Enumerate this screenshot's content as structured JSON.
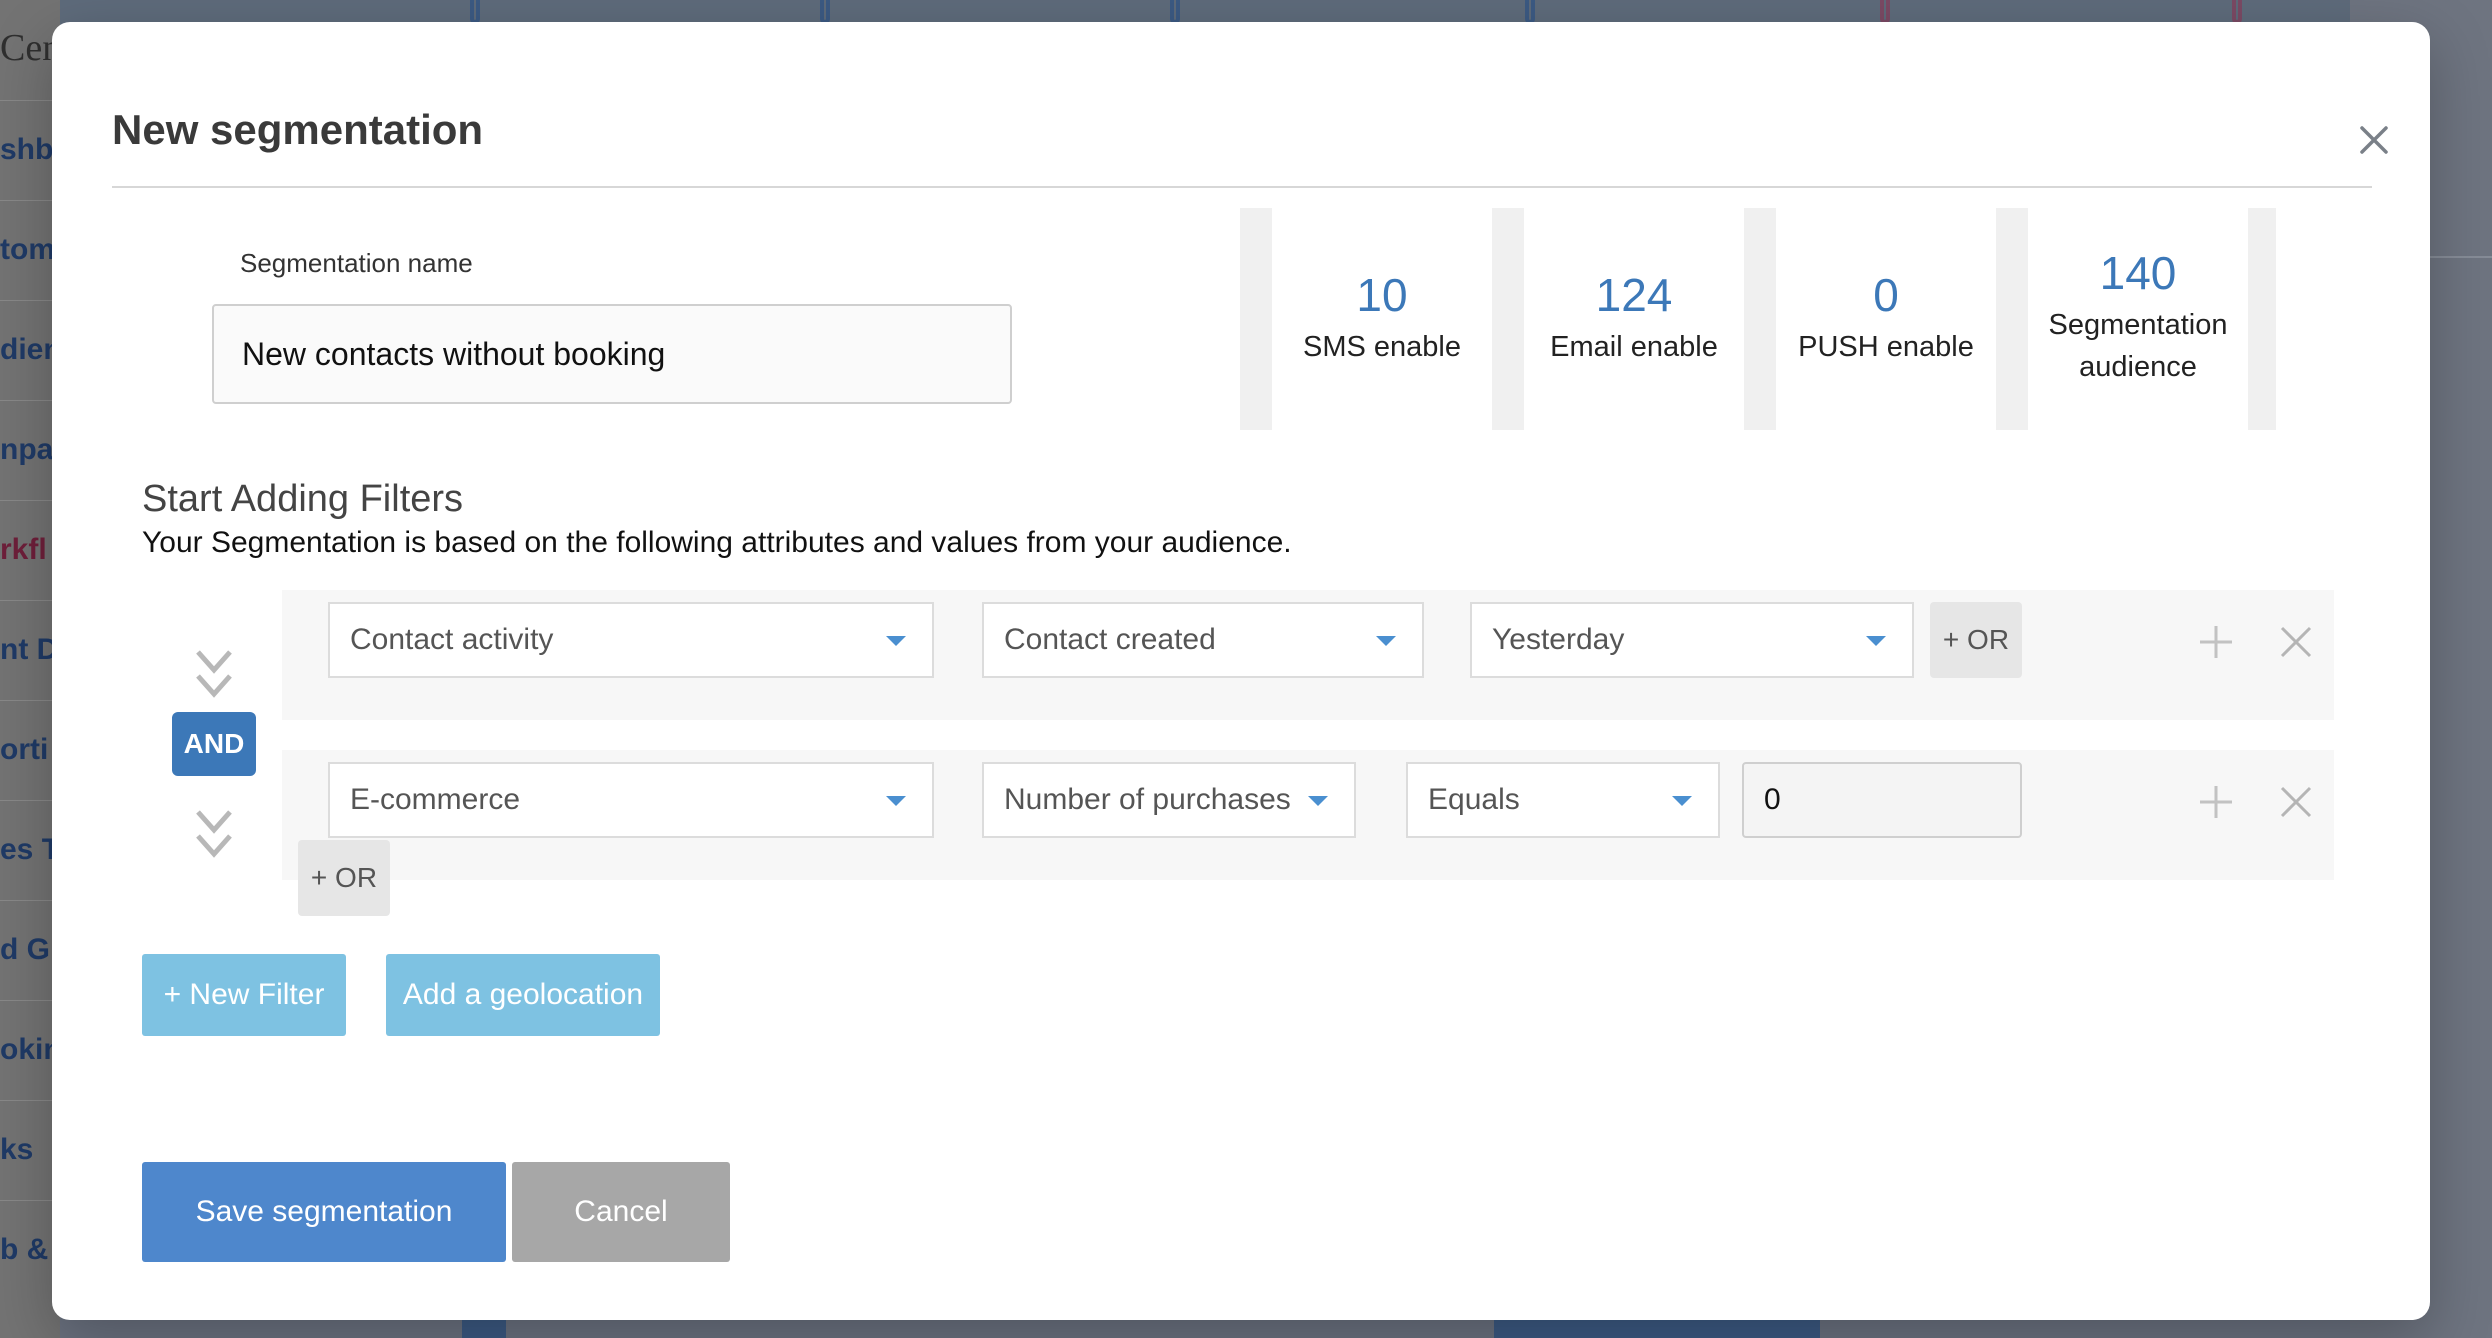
{
  "background": {
    "brand_fragment": "Cen",
    "nav_fragments": [
      "shbo",
      "tom",
      "dien",
      "npa",
      "rkfl",
      "nt D",
      "orti",
      "es T",
      "d G",
      "okin",
      "ks",
      "b &"
    ]
  },
  "modal": {
    "title": "New segmentation",
    "segmentation_name_label": "Segmentation name",
    "segmentation_name_value": "New contacts without booking",
    "stats": [
      {
        "number": "10",
        "label": "SMS enable"
      },
      {
        "number": "124",
        "label": "Email enable"
      },
      {
        "number": "0",
        "label": "PUSH enable"
      },
      {
        "number": "140",
        "label_line1": "Segmentation",
        "label_line2": "audience"
      }
    ],
    "filters_title": "Start Adding Filters",
    "filters_description": "Your Segmentation is based on the following attributes and values from your audience.",
    "and_label": "AND",
    "filter_rows": [
      {
        "field": "Contact activity",
        "attribute": "Contact created",
        "value": "Yesterday",
        "or_label": "+ OR"
      },
      {
        "field": "E-commerce",
        "attribute": "Number of purchases",
        "operator": "Equals",
        "value": "0",
        "or_label": "+ OR"
      }
    ],
    "new_filter_label": "+ New Filter",
    "add_geolocation_label": "Add a geolocation",
    "save_label": "Save segmentation",
    "cancel_label": "Cancel"
  },
  "colors": {
    "accent": "#3c78b8",
    "primary_button": "#4e87cc",
    "light_button": "#7ec2e2",
    "cancel_button": "#a7a7a7"
  },
  "icons": [
    "close-icon",
    "chevron-down-double-icon",
    "caret-down-icon",
    "move-icon",
    "remove-icon"
  ]
}
